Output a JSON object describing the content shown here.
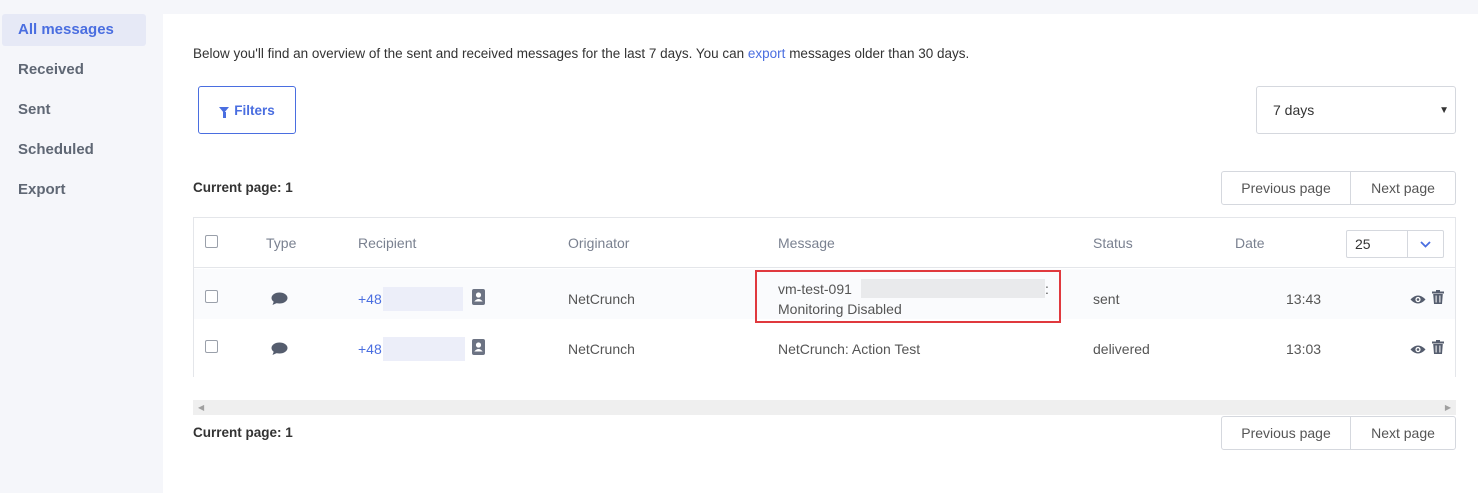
{
  "sidebar": {
    "items": [
      {
        "label": "All messages",
        "active": true
      },
      {
        "label": "Received"
      },
      {
        "label": "Sent"
      },
      {
        "label": "Scheduled"
      },
      {
        "label": "Export"
      }
    ]
  },
  "intro": {
    "before": "Below you'll find an overview of the sent and received messages for the last 7 days. You can ",
    "link": "export",
    "after": " messages older than 30 days."
  },
  "filters": {
    "label": "Filters"
  },
  "period_select": {
    "value": "7 days"
  },
  "pagination": {
    "current_label": "Current page: 1",
    "prev_label": "Previous page",
    "next_label": "Next page"
  },
  "table": {
    "columns": {
      "type": "Type",
      "recipient": "Recipient",
      "originator": "Originator",
      "message": "Message",
      "status": "Status",
      "date": "Date"
    },
    "per_page": "25",
    "rows": [
      {
        "recipient": "+48",
        "originator": "NetCrunch",
        "message_line1": "vm-test-091",
        "message_suffix": ":",
        "message_line2": "Monitoring Disabled",
        "status": "sent",
        "date": "13:43"
      },
      {
        "recipient": "+48",
        "originator": "NetCrunch",
        "message_line1": "NetCrunch: Action Test",
        "status": "delivered",
        "date": "13:03"
      }
    ]
  },
  "colors": {
    "accent": "#4a6ee0",
    "highlight": "#e0393e"
  }
}
